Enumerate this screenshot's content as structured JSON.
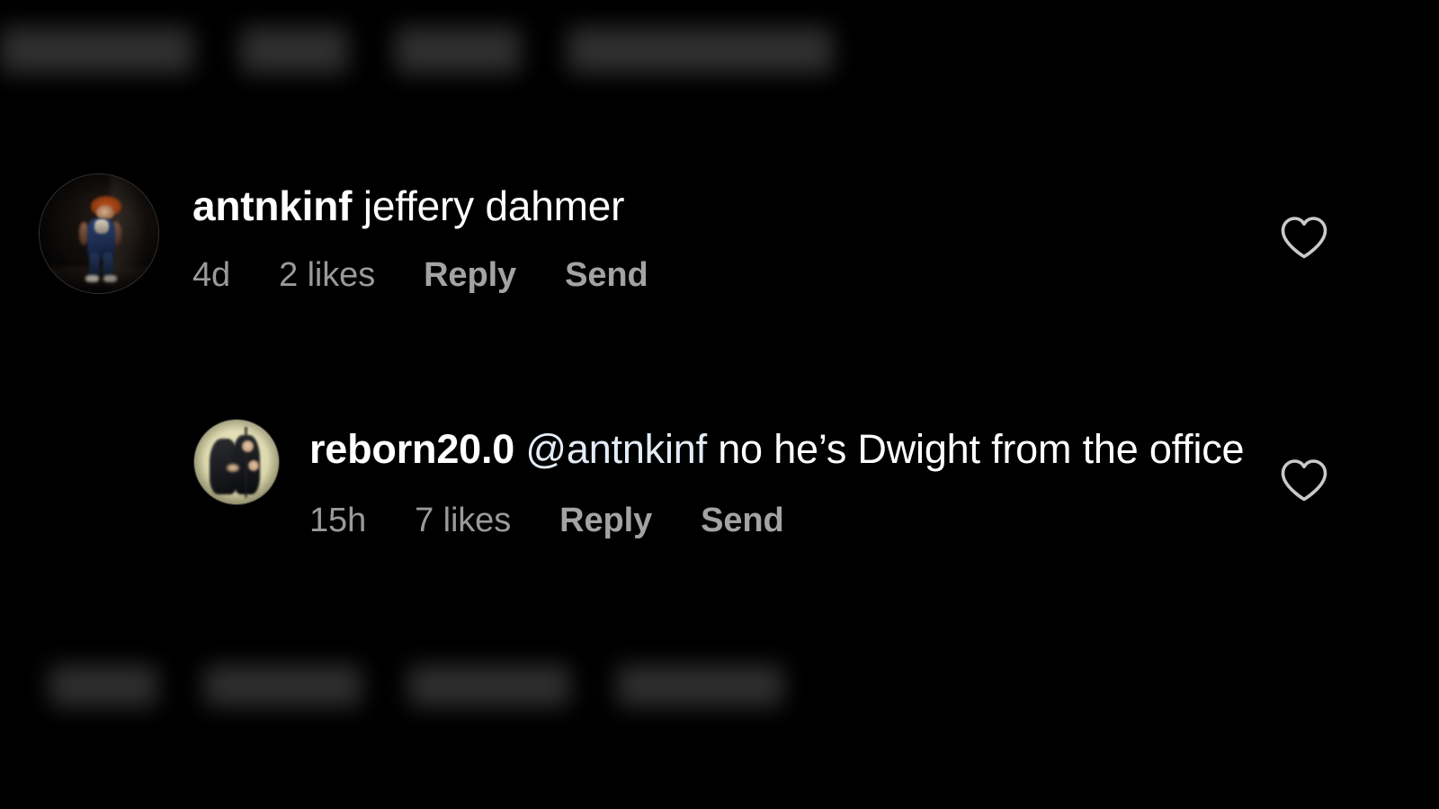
{
  "app": {
    "name": "instagram-comments",
    "background_color": "#000000",
    "text_color": "#ffffff",
    "meta_text_color": "#9a9a9a",
    "mention_color": "#e3ecf6"
  },
  "blurred_rows": {
    "top": {
      "description": "blurred partially cut-off comment meta row",
      "chip_widths": [
        215,
        120,
        140,
        295
      ]
    },
    "bottom": {
      "description": "blurred comment meta row",
      "chip_widths": [
        120,
        175,
        180,
        185
      ]
    }
  },
  "comments": [
    {
      "avatar_name": "avatar-antnkinf",
      "username": "antnkinf",
      "text": "jeffery dahmer",
      "mention": "",
      "timestamp": "4d",
      "likes": "2 likes",
      "reply_label": "Reply",
      "send_label": "Send",
      "like_icon": "heart-outline-icon",
      "liked": false
    },
    {
      "avatar_name": "avatar-reborn200",
      "username": "reborn20.0",
      "mention": "@antnkinf",
      "text": "no he’s Dwight from the office",
      "timestamp": "15h",
      "likes": "7 likes",
      "reply_label": "Reply",
      "send_label": "Send",
      "like_icon": "heart-outline-icon",
      "liked": false
    }
  ]
}
